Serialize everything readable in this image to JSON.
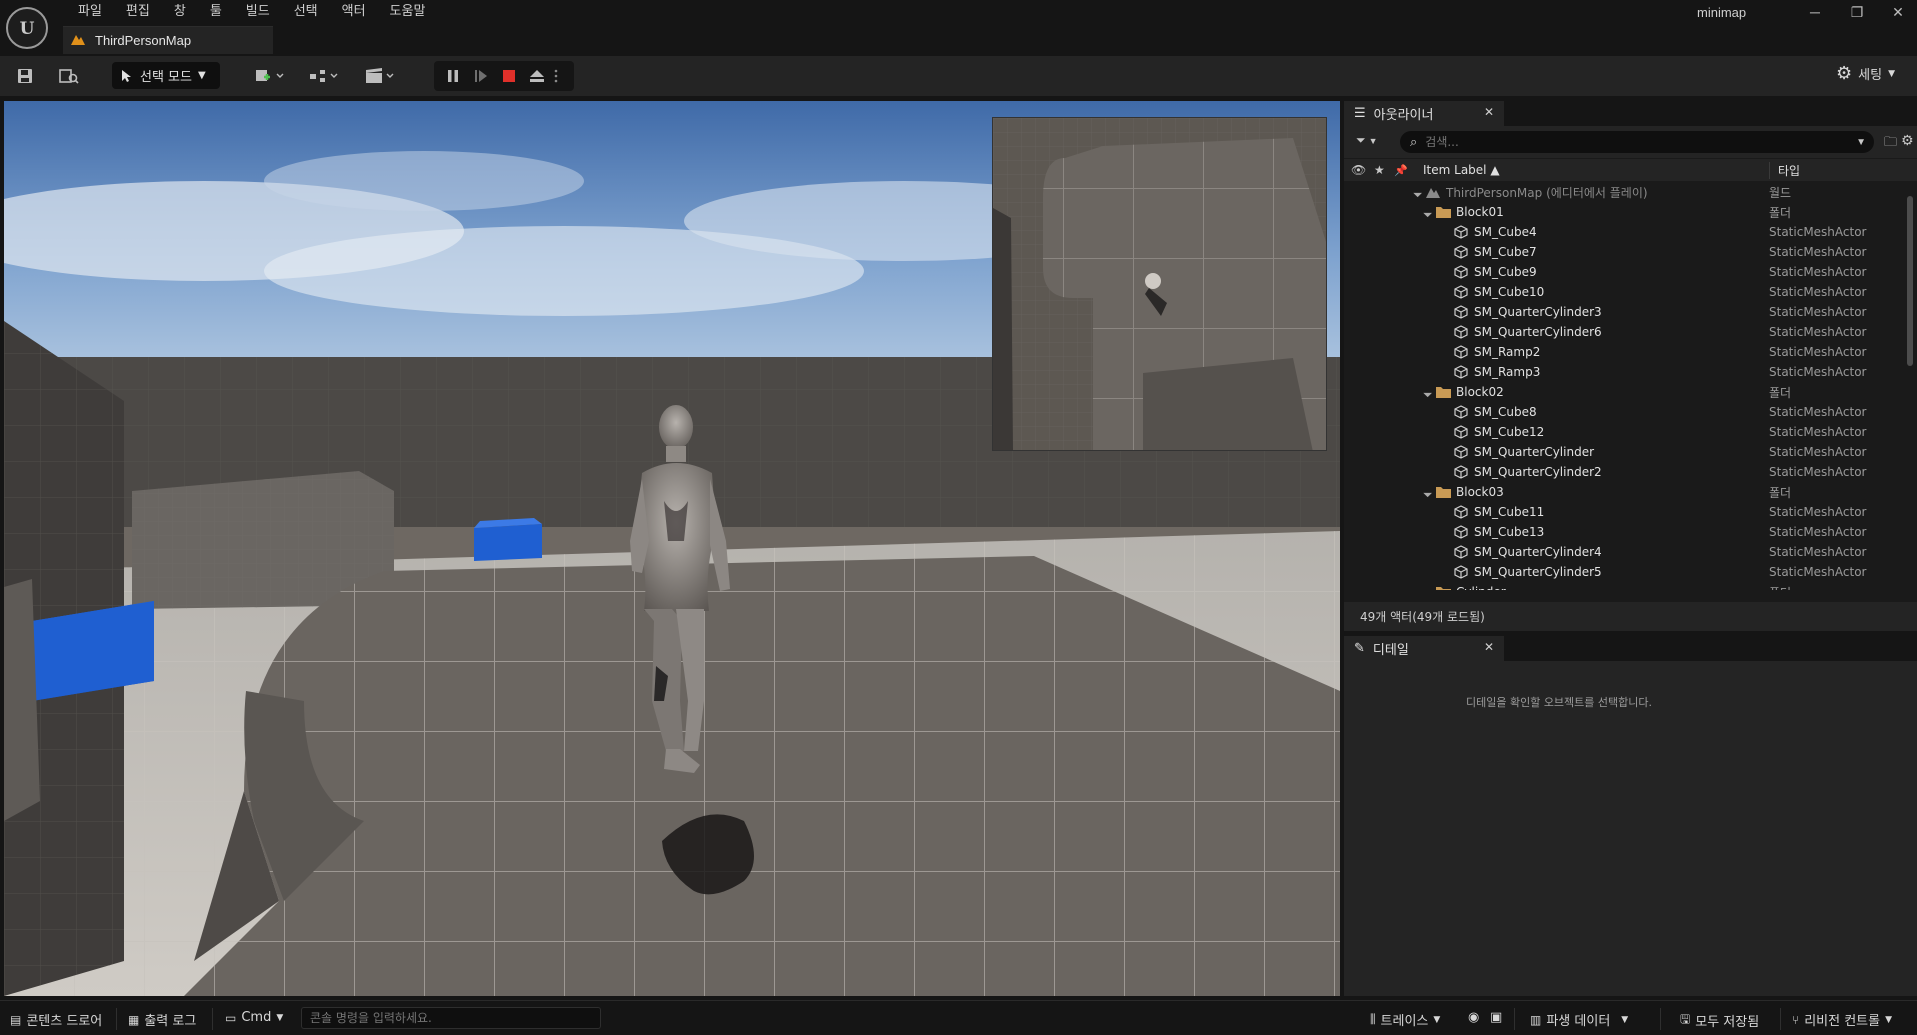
{
  "menu": [
    "파일",
    "편집",
    "창",
    "툴",
    "빌드",
    "선택",
    "액터",
    "도움말"
  ],
  "document_tab": {
    "label": "ThirdPersonMap"
  },
  "project_name": "minimap",
  "toolbar": {
    "mode_label": "선택 모드",
    "settings_label": "세팅"
  },
  "outliner": {
    "tab_label": "아웃라이너",
    "search_placeholder": "검색...",
    "col_label": "Item Label ▲",
    "col_type": "타입",
    "rows": [
      {
        "label": "ThirdPersonMap (에디터에서 플레이)",
        "type": "월드",
        "kind": "world",
        "depth": 0
      },
      {
        "label": "Block01",
        "type": "폴더",
        "kind": "folder",
        "depth": 1
      },
      {
        "label": "SM_Cube4",
        "type": "StaticMeshActor",
        "kind": "mesh",
        "depth": 2
      },
      {
        "label": "SM_Cube7",
        "type": "StaticMeshActor",
        "kind": "mesh",
        "depth": 2
      },
      {
        "label": "SM_Cube9",
        "type": "StaticMeshActor",
        "kind": "mesh",
        "depth": 2
      },
      {
        "label": "SM_Cube10",
        "type": "StaticMeshActor",
        "kind": "mesh",
        "depth": 2
      },
      {
        "label": "SM_QuarterCylinder3",
        "type": "StaticMeshActor",
        "kind": "mesh",
        "depth": 2
      },
      {
        "label": "SM_QuarterCylinder6",
        "type": "StaticMeshActor",
        "kind": "mesh",
        "depth": 2
      },
      {
        "label": "SM_Ramp2",
        "type": "StaticMeshActor",
        "kind": "mesh",
        "depth": 2
      },
      {
        "label": "SM_Ramp3",
        "type": "StaticMeshActor",
        "kind": "mesh",
        "depth": 2
      },
      {
        "label": "Block02",
        "type": "폴더",
        "kind": "folder",
        "depth": 1
      },
      {
        "label": "SM_Cube8",
        "type": "StaticMeshActor",
        "kind": "mesh",
        "depth": 2
      },
      {
        "label": "SM_Cube12",
        "type": "StaticMeshActor",
        "kind": "mesh",
        "depth": 2
      },
      {
        "label": "SM_QuarterCylinder",
        "type": "StaticMeshActor",
        "kind": "mesh",
        "depth": 2
      },
      {
        "label": "SM_QuarterCylinder2",
        "type": "StaticMeshActor",
        "kind": "mesh",
        "depth": 2
      },
      {
        "label": "Block03",
        "type": "폴더",
        "kind": "folder",
        "depth": 1
      },
      {
        "label": "SM_Cube11",
        "type": "StaticMeshActor",
        "kind": "mesh",
        "depth": 2
      },
      {
        "label": "SM_Cube13",
        "type": "StaticMeshActor",
        "kind": "mesh",
        "depth": 2
      },
      {
        "label": "SM_QuarterCylinder4",
        "type": "StaticMeshActor",
        "kind": "mesh",
        "depth": 2
      },
      {
        "label": "SM_QuarterCylinder5",
        "type": "StaticMeshActor",
        "kind": "mesh",
        "depth": 2
      },
      {
        "label": "Cylinder",
        "type": "폴더",
        "kind": "folder",
        "depth": 1
      }
    ],
    "status": "49개 액터(49개 로드됨)"
  },
  "details": {
    "tab_label": "디테일",
    "empty_message": "디테일을 확인할 오브젝트를 선택합니다."
  },
  "bottombar": {
    "content_drawer": "콘텐츠 드로어",
    "output_log": "출력 로그",
    "cmd": "Cmd",
    "console_placeholder": "콘솔 명령을 입력하세요.",
    "trace": "트레이스",
    "derived_data": "파생 데이터",
    "all_saved": "모두 저장됨",
    "revision_control": "리비전 컨트롤"
  },
  "colors": {
    "accent_stop": "#e0302a",
    "cube_blue": "#1f5fd1",
    "tab_warning": "#e0901a"
  }
}
